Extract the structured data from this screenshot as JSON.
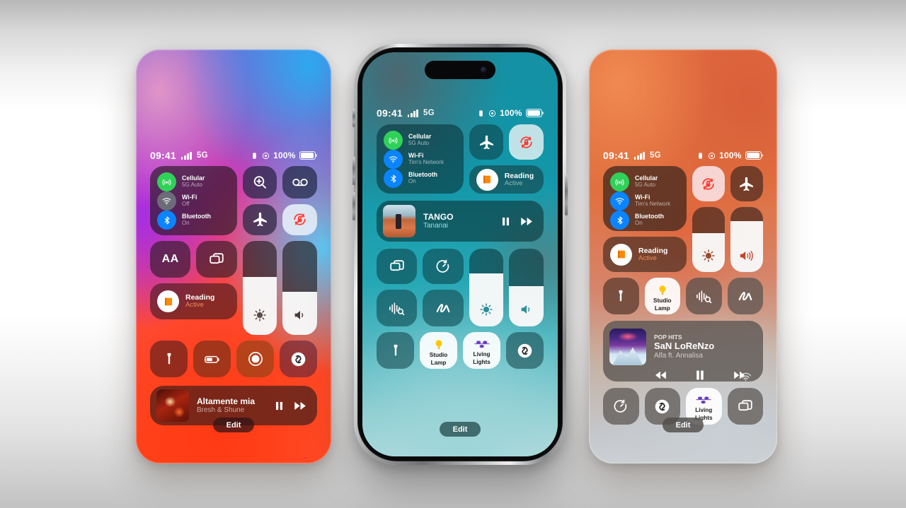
{
  "scene": {
    "title": "iOS Control Center — three iPhone mockups",
    "background_top": "#b8b8b8",
    "background_mid": "#ffffff",
    "background_bottom": "#c2c2c2"
  },
  "status_bar": {
    "time": "09:41",
    "network": "5G",
    "battery_percent": "100%",
    "signal_icon": "cellular-bars-icon",
    "orientation_lock_icon": "portrait-lock-icon",
    "focus_icon": "focus-indicator-icon",
    "battery_icon": "battery-full-icon"
  },
  "connectivity": {
    "cellular": {
      "title": "Cellular",
      "subtitle": "5G Auto",
      "icon": "cellular-antenna-icon",
      "color": "#30d158"
    },
    "wifi_off": {
      "title": "Wi-Fi",
      "subtitle": "Off",
      "icon": "wifi-icon",
      "color": "#6c6c78"
    },
    "wifi_on": {
      "title": "Wi-Fi",
      "subtitle": "Tim's Network",
      "icon": "wifi-icon",
      "color": "#0a84ff"
    },
    "bluetooth": {
      "title": "Bluetooth",
      "subtitle": "On",
      "icon": "bluetooth-icon",
      "color": "#0a84ff"
    }
  },
  "focus": {
    "title": "Reading",
    "subtitle": "Active",
    "icon": "reading-book-icon",
    "accent": "#f08a5a"
  },
  "tiles": {
    "magnifier": "magnifier-icon",
    "voicemail": "voicemail-icon",
    "airplane": "airplane-mode-icon",
    "rotation_lock": "rotation-lock-icon",
    "text_size": "text-size-icon",
    "text_size_label": "AA",
    "screen_mirroring": "screen-mirroring-icon",
    "flashlight": "flashlight-icon",
    "low_power": "low-power-battery-icon",
    "screen_record": "screen-record-icon",
    "shazam": "shazam-icon",
    "timer": "timer-icon",
    "sound_recognition": "sound-recognition-icon",
    "quick_note": "quick-note-icon",
    "brightness": "brightness-icon",
    "volume": "volume-icon"
  },
  "home_controls": {
    "studio_lamp": {
      "label": "Studio\nLamp",
      "label_line1": "Studio",
      "label_line2": "Lamp",
      "icon": "light-bulb-icon",
      "color": "#ffc800"
    },
    "living_lights": {
      "label_line1": "Living",
      "label_line2": "Lights",
      "icon": "light-strip-icon",
      "color": "#6a3ec4"
    }
  },
  "sliders": {
    "brightness_level": 62,
    "volume_level": 46,
    "brightness_level_right": 62,
    "volume_level_right": 76
  },
  "edit_button": {
    "label": "Edit"
  },
  "phones": [
    {
      "id": "phone-left",
      "name": "iPhone — blue / magenta / orange gradient wallpaper",
      "media": {
        "kicker": "",
        "title": "Altamente mia",
        "artist": "Bresh & Shune",
        "artwork": "red-concert-artwork"
      },
      "sliders": {
        "brightness": 62,
        "volume": 46
      }
    },
    {
      "id": "phone-center",
      "name": "iPhone Pro with titanium frame — teal wallpaper",
      "media": {
        "kicker": "",
        "title": "TANGO",
        "artist": "Tananai",
        "artwork": "desert-figure-artwork"
      },
      "sliders": {
        "brightness": 68,
        "volume": 52
      }
    },
    {
      "id": "phone-right",
      "name": "iPhone — orange / grey gradient wallpaper",
      "media": {
        "kicker": "POP HITS",
        "title": "SaN LoReNzo",
        "artist": "Alfa ft. Annalisa",
        "artwork": "mountain-night-artwork"
      },
      "sliders": {
        "brightness": 60,
        "volume": 78
      },
      "media_controls": [
        "rewind-icon",
        "pause-icon",
        "fast-forward-icon",
        "airplay-icon"
      ]
    }
  ]
}
